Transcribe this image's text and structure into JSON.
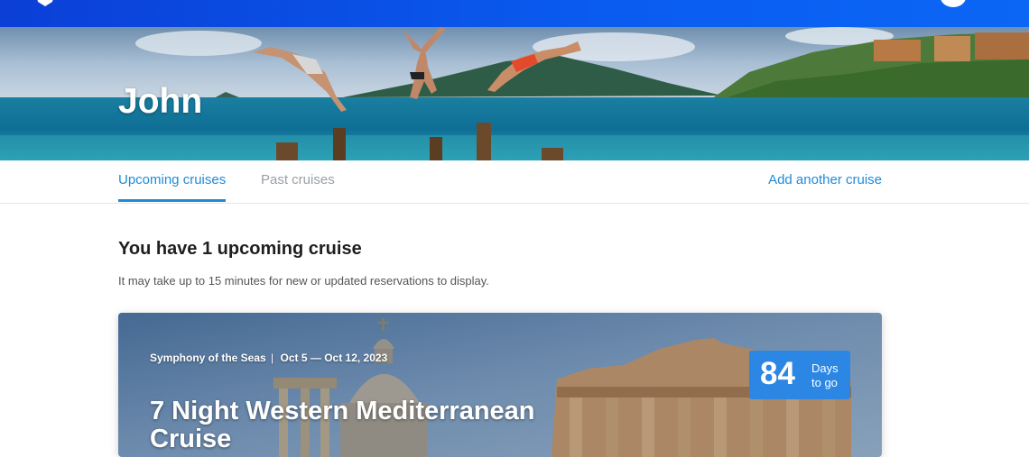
{
  "header": {
    "logo_icon": "anchor-icon",
    "avatar_icon": "user-avatar-icon"
  },
  "hero": {
    "name": "John"
  },
  "tabs": {
    "upcoming": "Upcoming cruises",
    "past": "Past cruises",
    "add": "Add another cruise"
  },
  "main": {
    "heading": "You have 1 upcoming cruise",
    "notice": "It may take up to 15 minutes for new or updated reservations to display."
  },
  "cruise": {
    "ship": "Symphony of the Seas",
    "separator": "|",
    "dates": "Oct 5 — Oct 12, 2023",
    "title": "7 Night Western Mediterranean Cruise",
    "days": "84",
    "days_label": "Days to go"
  },
  "colors": {
    "nav": "#0a5cf0",
    "accent": "#1f8ad8",
    "countdown": "#2b86e4"
  }
}
